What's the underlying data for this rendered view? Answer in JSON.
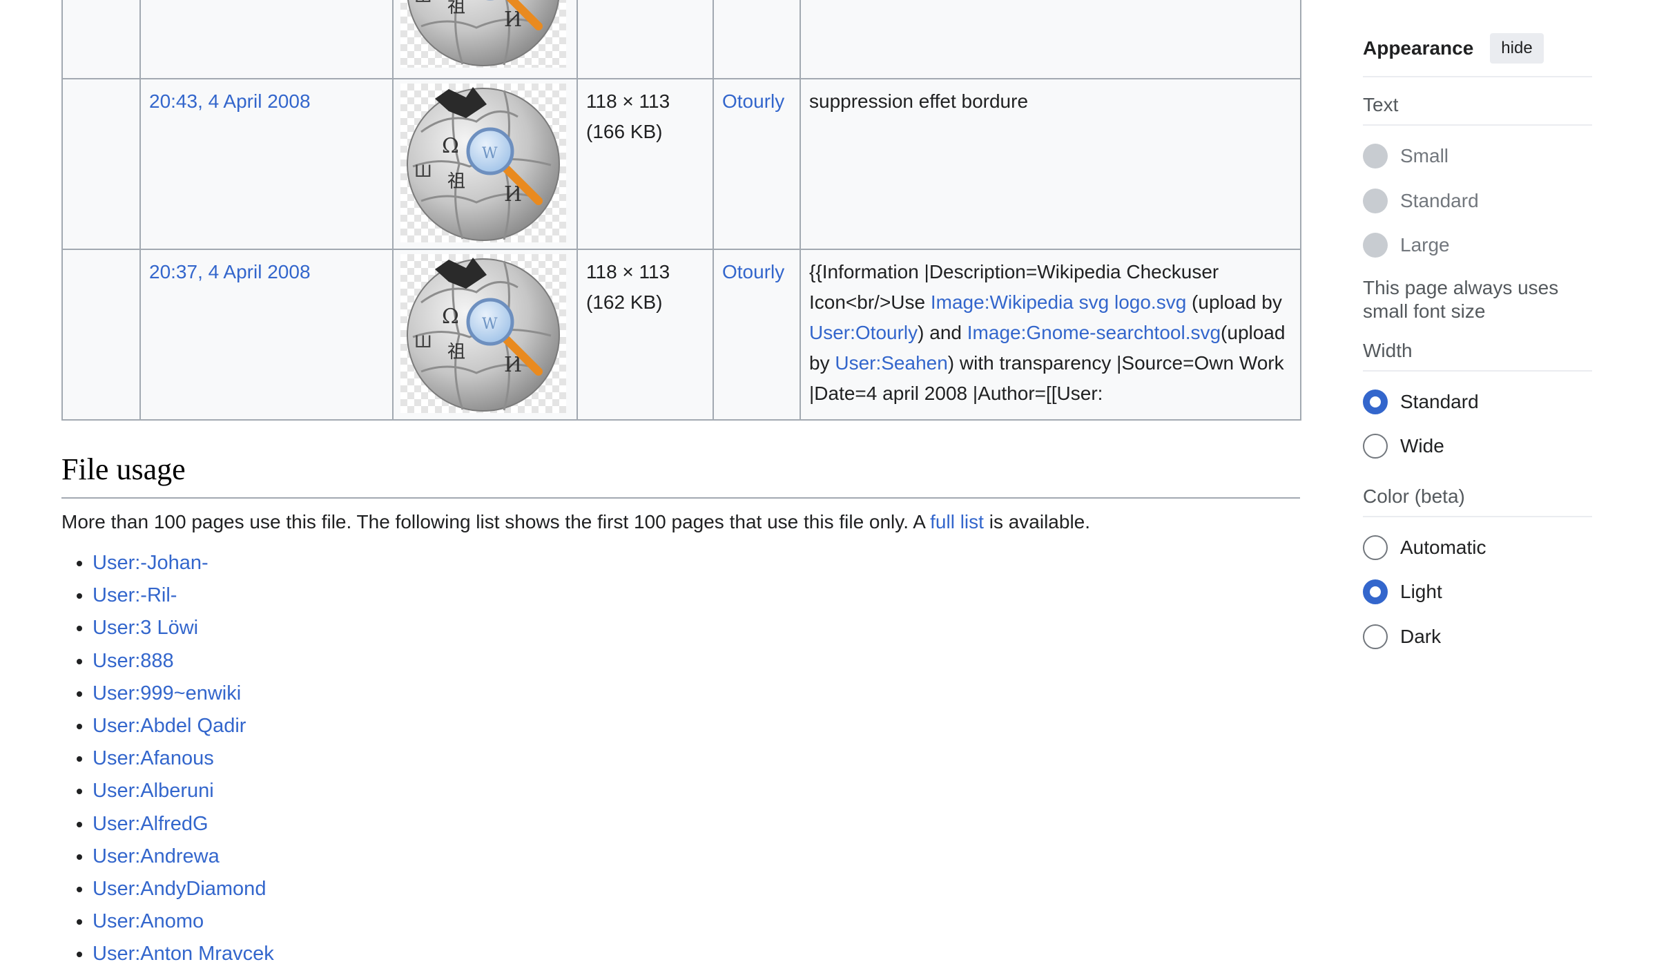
{
  "history_rows": [
    {
      "datetime": "",
      "dimensions": "",
      "size": "",
      "user": "",
      "comment_parts": []
    },
    {
      "datetime": "20:43, 4 April 2008",
      "dimensions": "118 × 113",
      "size": "(166 KB)",
      "user": "Otourly",
      "comment_parts": [
        {
          "text": "suppression effet bordure",
          "link": false
        }
      ]
    },
    {
      "datetime": "20:37, 4 April 2008",
      "dimensions": "118 × 113",
      "size": "(162 KB)",
      "user": "Otourly",
      "comment_parts": [
        {
          "text": "{{Information |Description=Wikipedia Checkuser Icon<br/>Use ",
          "link": false
        },
        {
          "text": "Image:Wikipedia svg logo.svg",
          "link": true
        },
        {
          "text": " (upload by ",
          "link": false
        },
        {
          "text": "User:Otourly",
          "link": true
        },
        {
          "text": ") and ",
          "link": false
        },
        {
          "text": "Image:Gnome-searchtool.svg",
          "link": true
        },
        {
          "text": "(upload by ",
          "link": false
        },
        {
          "text": "User:Seahen",
          "link": true
        },
        {
          "text": ") with transparency |Source=Own Work |Date=4 april 2008 |Author=[[User:",
          "link": false
        }
      ]
    }
  ],
  "file_usage": {
    "heading": "File usage",
    "intro_before": "More than 100 pages use this file. The following list shows the first 100 pages that use this file only. A ",
    "intro_link": "full list",
    "intro_after": " is available.",
    "pages": [
      "User:-Johan-",
      "User:-Ril-",
      "User:3 Löwi",
      "User:888",
      "User:999~enwiki",
      "User:Abdel Qadir",
      "User:Afanous",
      "User:Alberuni",
      "User:AlfredG",
      "User:Andrewa",
      "User:AndyDiamond",
      "User:Anomo",
      "User:Anton Mravcek"
    ]
  },
  "appearance": {
    "title": "Appearance",
    "hide_label": "hide",
    "text_section": {
      "label": "Text",
      "options": [
        "Small",
        "Standard",
        "Large"
      ],
      "note": "This page always uses small font size"
    },
    "width_section": {
      "label": "Width",
      "options": [
        "Standard",
        "Wide"
      ],
      "selected": "Standard"
    },
    "color_section": {
      "label": "Color (beta)",
      "options": [
        "Automatic",
        "Light",
        "Dark"
      ],
      "selected": "Light"
    }
  },
  "colors": {
    "link": "#3366cc",
    "table_border": "#a2a9b1",
    "table_background": "#f8f9fa",
    "radio_checked": "#3366cc"
  }
}
